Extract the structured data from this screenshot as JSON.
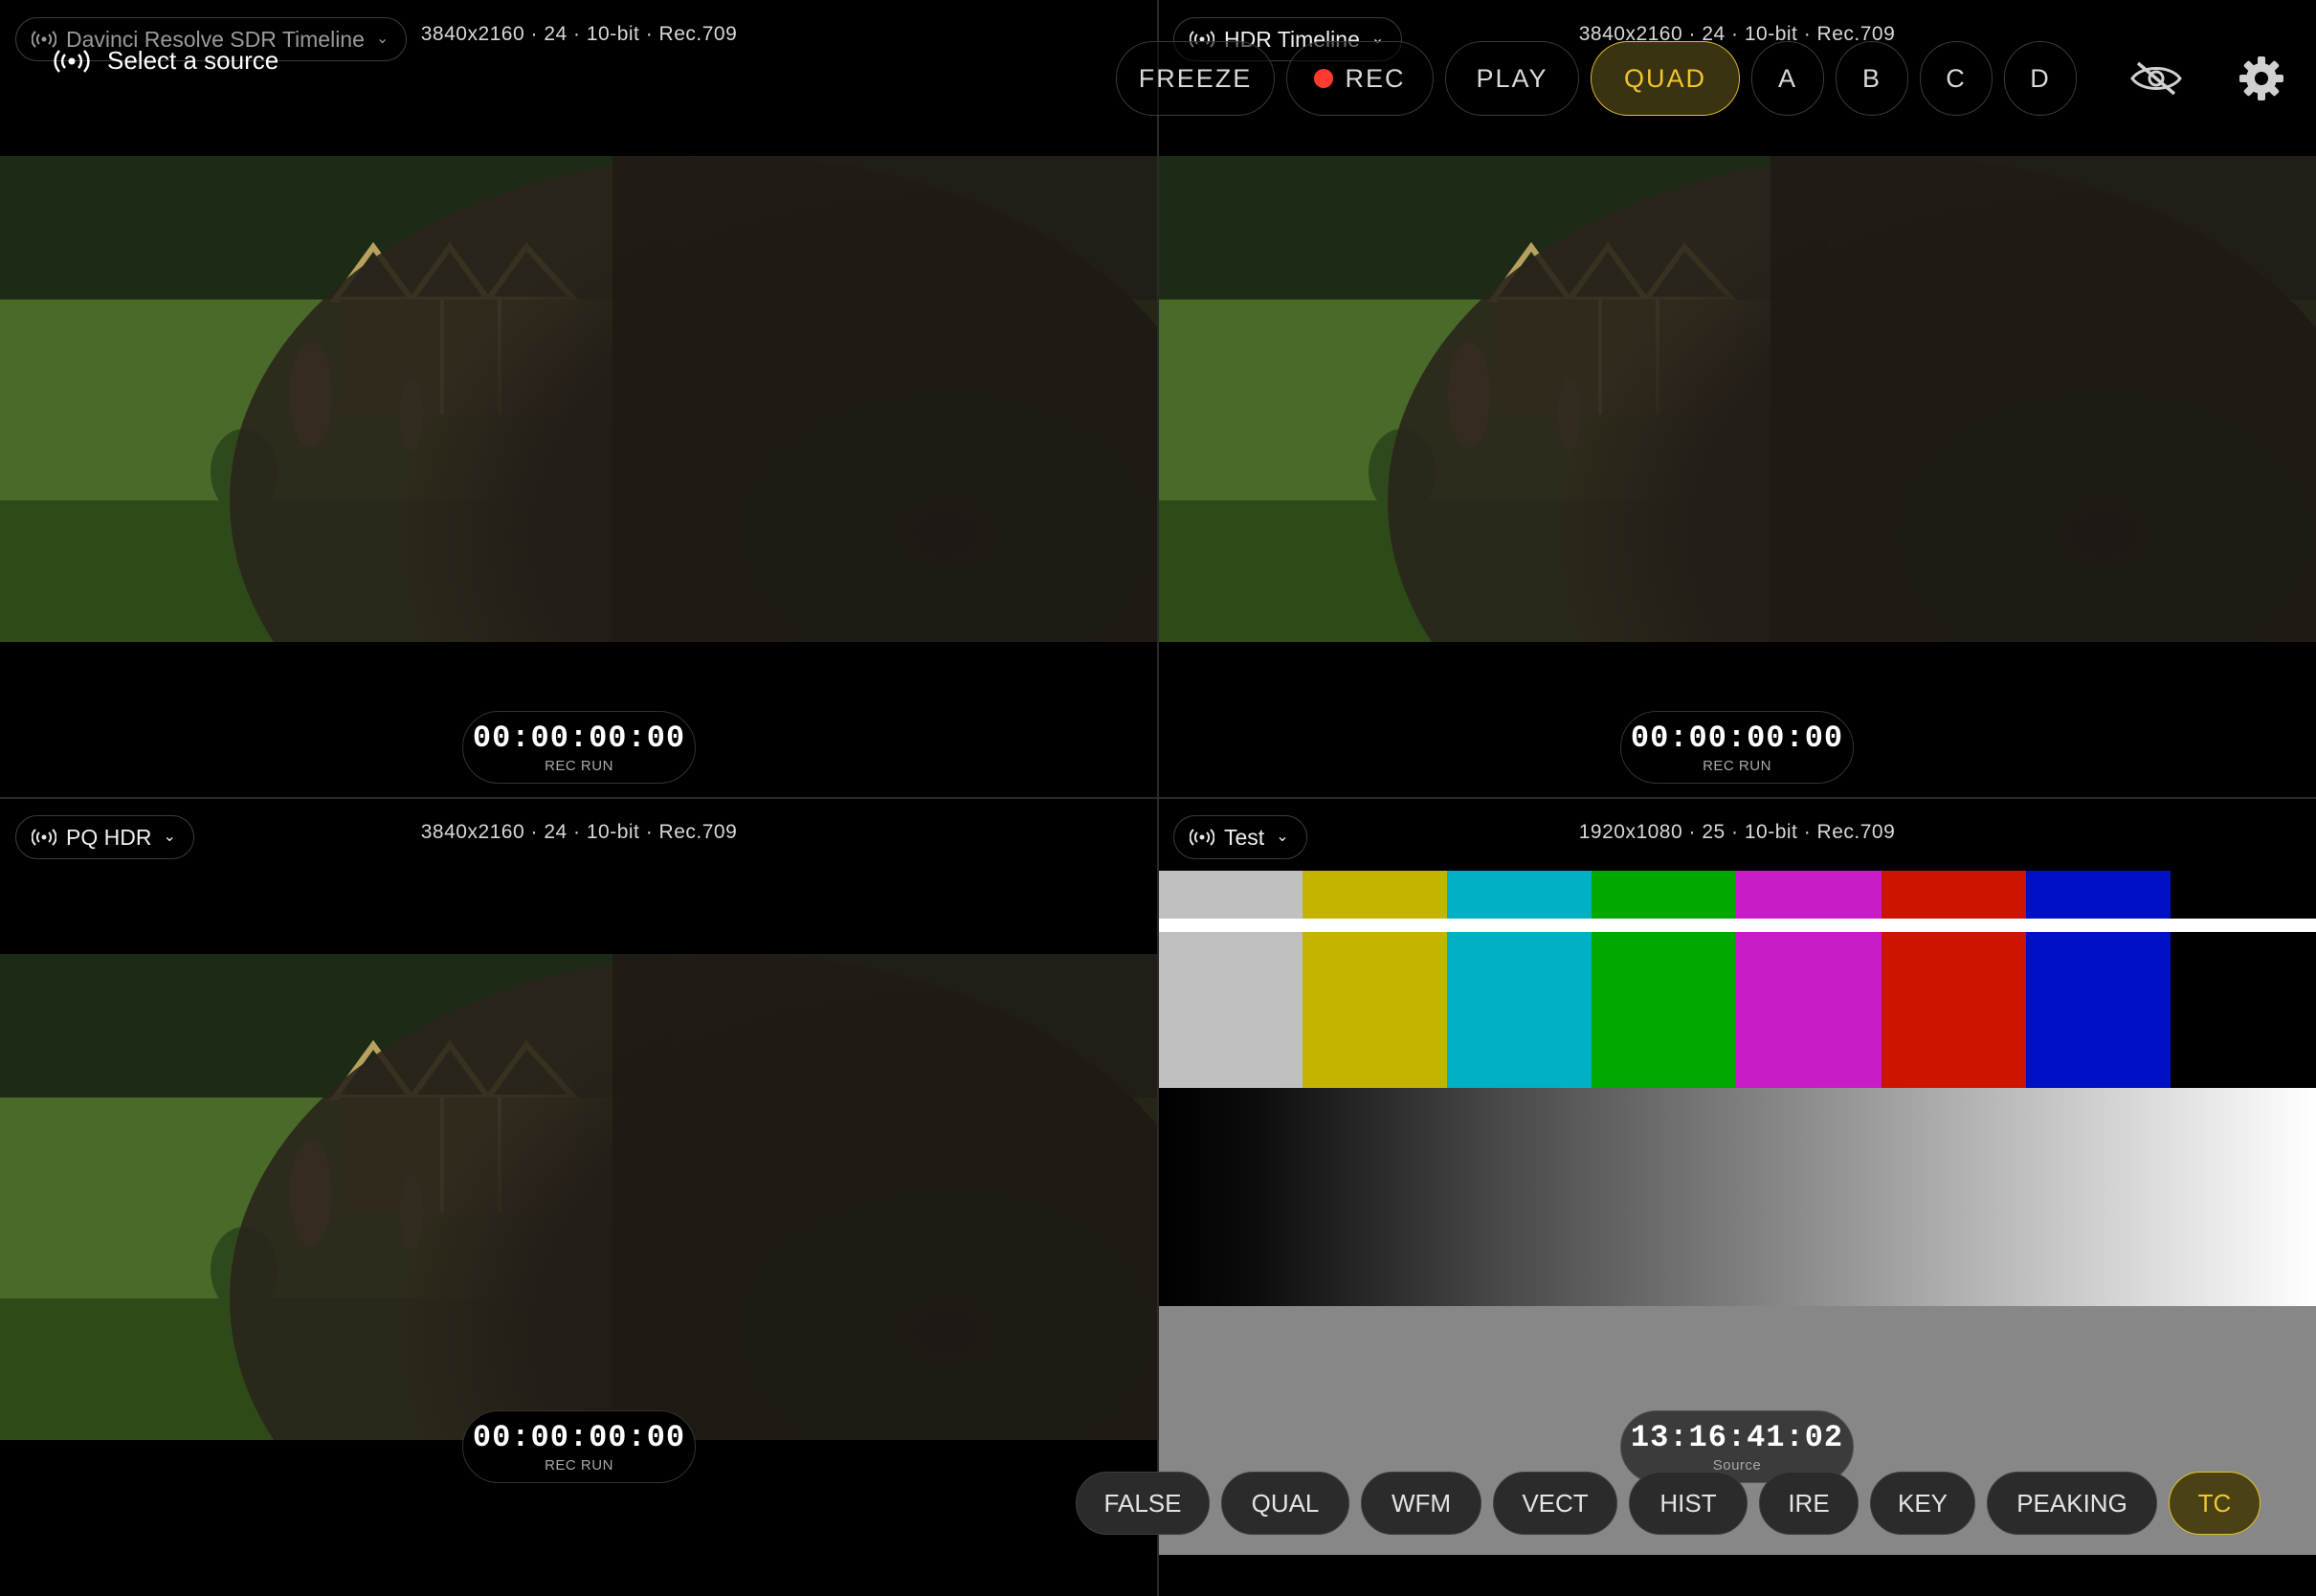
{
  "hint": {
    "label": "Select a source",
    "icon": "broadcast-icon"
  },
  "quadrants": [
    {
      "id": "A",
      "source": "Davinci Resolve SDR Timeline",
      "format": "3840x2160 · 24 · 10-bit · Rec.709",
      "timecode": "00:00:00:00",
      "tc_label": "REC RUN"
    },
    {
      "id": "B",
      "source": "HDR Timeline",
      "format": "3840x2160 · 24 · 10-bit · Rec.709",
      "timecode": "00:00:00:00",
      "tc_label": "REC RUN"
    },
    {
      "id": "C",
      "source": "PQ HDR",
      "format": "3840x2160 · 24 · 10-bit · Rec.709",
      "timecode": "00:00:00:00",
      "tc_label": "REC RUN"
    },
    {
      "id": "D",
      "source": "Test",
      "format": "1920x1080 · 25 · 10-bit · Rec.709",
      "timecode": "13:16:41:02",
      "tc_label": "Source"
    }
  ],
  "toolbar": {
    "freeze": "FREEZE",
    "rec": "REC",
    "play": "PLAY",
    "quad": "QUAD",
    "a": "A",
    "b": "B",
    "c": "C",
    "d": "D",
    "active": "QUAD",
    "rec_color": "#ff3b30",
    "accent": "#f2c430"
  },
  "scopes": {
    "items": [
      "FALSE",
      "QUAL",
      "WFM",
      "VECT",
      "HIST",
      "IRE",
      "KEY",
      "PEAKING",
      "TC"
    ],
    "active": "TC"
  },
  "test_pattern": {
    "bar_colors": [
      "#c0c0c0",
      "#c4b400",
      "#00b0c4",
      "#00a800",
      "#c81cc8",
      "#cc1400",
      "#0010c4",
      "#000000"
    ]
  }
}
